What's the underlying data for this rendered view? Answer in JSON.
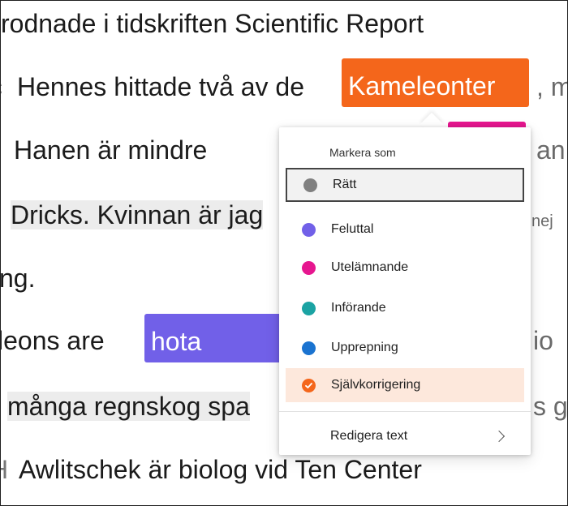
{
  "document": {
    "lines": [
      "rodnade i tidskriften Scientific Report",
      "Hennes hittade två av de",
      "Hanen är mindre",
      "Dricks. Kvinnan är jag",
      "ng.",
      "leons are",
      "många regnskog spa",
      "Awlitschek är biolog vid Ten Center"
    ],
    "highlights": {
      "orange_word": "Kameleonter",
      "purple_word": "hota"
    },
    "right_fragments": [
      ", m",
      "an",
      "nej",
      "io",
      "s g"
    ],
    "left_fragments": [
      "c",
      "H"
    ]
  },
  "colors": {
    "orange": "#f4661b",
    "pink": "#e6168f",
    "purple": "#7160e8",
    "gray": "#808080",
    "teal": "#1ba3a3",
    "blue": "#1a73d0",
    "selected_bg": "#f2f2f2",
    "check_bg": "#fde8dc"
  },
  "menu": {
    "header": "Markera som",
    "items": [
      {
        "label": "Rätt",
        "icon": "gray-dot-icon",
        "color": "#808080"
      },
      {
        "label": "Feluttal",
        "icon": "purple-dot-icon",
        "color": "#7160e8"
      },
      {
        "label": "Utelämnande",
        "icon": "pink-dot-icon",
        "color": "#e6168f"
      },
      {
        "label": "Införande",
        "icon": "teal-dot-icon",
        "color": "#1ba3a3"
      },
      {
        "label": "Upprepning",
        "icon": "blue-dot-icon",
        "color": "#1a73d0"
      },
      {
        "label": "Självkorrigering",
        "icon": "check-circle-icon",
        "color": "#f4661b"
      }
    ],
    "edit_text": "Redigera text"
  }
}
